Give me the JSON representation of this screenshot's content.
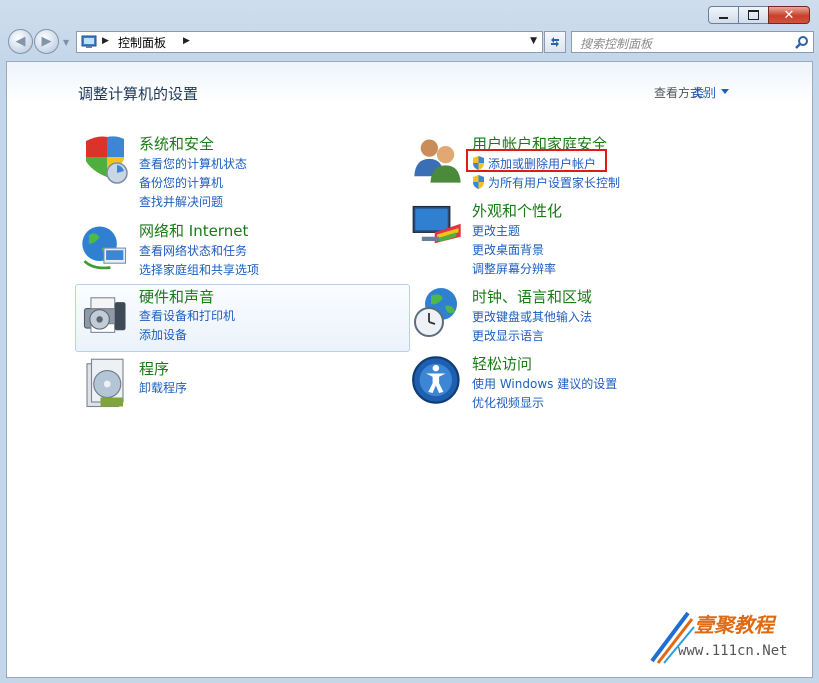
{
  "window": {
    "minimize_label": "",
    "maximize_label": "",
    "close_label": "✕"
  },
  "address": {
    "crumb": "控制面板",
    "refresh_icon": "refresh-icon",
    "search_placeholder": "搜索控制面板"
  },
  "header": {
    "title": "调整计算机的设置",
    "view_by_label": "查看方式:",
    "view_by_value": "类别"
  },
  "categories": [
    {
      "title": "系统和安全",
      "icon": "system-security-icon",
      "links": [
        "查看您的计算机状态",
        "备份您的计算机",
        "查找并解决问题"
      ]
    },
    {
      "title": "网络和 Internet",
      "icon": "network-icon",
      "links": [
        "查看网络状态和任务",
        "选择家庭组和共享选项"
      ]
    },
    {
      "title": "硬件和声音",
      "icon": "hardware-sound-icon",
      "links": [
        "查看设备和打印机",
        "添加设备"
      ]
    },
    {
      "title": "程序",
      "icon": "programs-icon",
      "links": [
        "卸载程序"
      ]
    },
    {
      "title": "用户帐户和家庭安全",
      "icon": "user-accounts-icon",
      "links": [
        "添加或删除用户帐户",
        "为所有用户设置家长控制"
      ]
    },
    {
      "title": "外观和个性化",
      "icon": "appearance-icon",
      "links": [
        "更改主题",
        "更改桌面背景",
        "调整屏幕分辨率"
      ]
    },
    {
      "title": "时钟、语言和区域",
      "icon": "clock-language-icon",
      "links": [
        "更改键盘或其他输入法",
        "更改显示语言"
      ]
    },
    {
      "title": "轻松访问",
      "icon": "ease-of-access-icon",
      "links": [
        "使用 Windows 建议的设置",
        "优化视频显示"
      ]
    }
  ],
  "watermark": {
    "line1": "壹聚教程",
    "line2": "www.111cn.Net"
  },
  "colors": {
    "category_title": "#1a7a16",
    "link": "#1e5ebf",
    "highlight": "#e01919"
  }
}
